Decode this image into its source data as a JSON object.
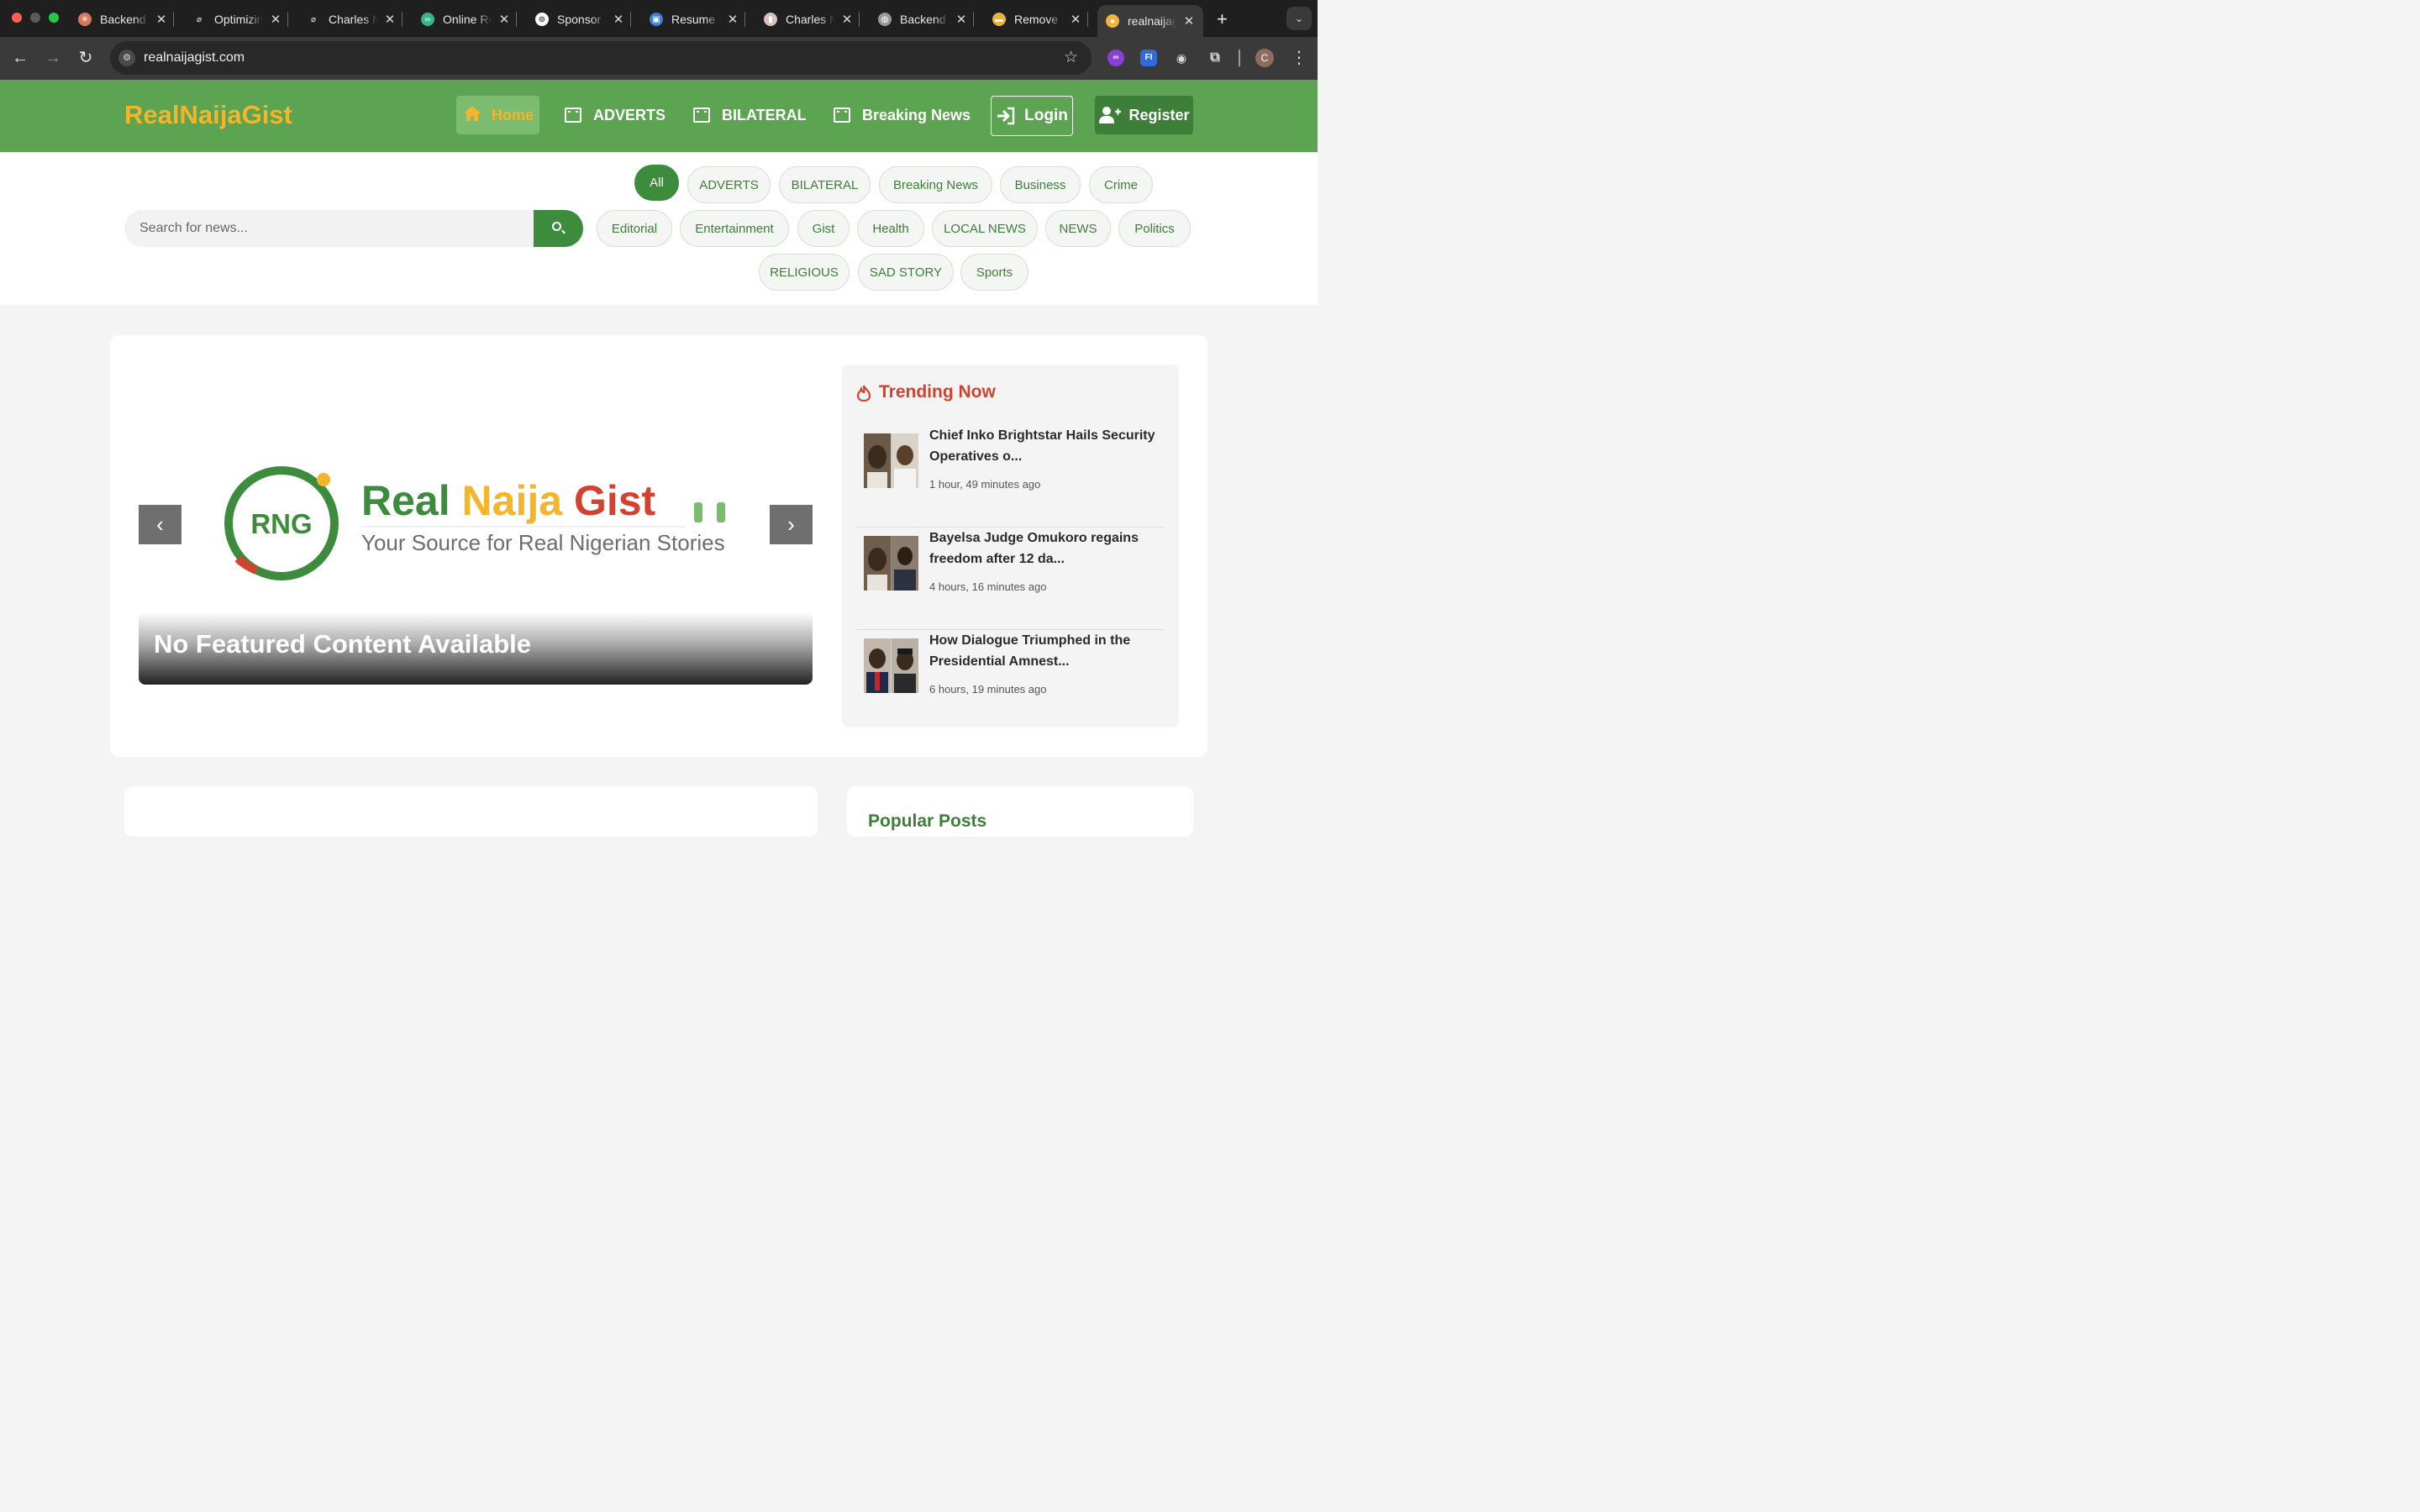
{
  "browser": {
    "tabs": [
      {
        "title": "Backend Developer",
        "fav_color": "#d97757",
        "fav": "✳"
      },
      {
        "title": "Optimizing",
        "fav_color": "#1f1f1f",
        "fav": "⌀"
      },
      {
        "title": "Charles Mbachu",
        "fav_color": "#1f1f1f",
        "fav": "⌀"
      },
      {
        "title": "Online Resume",
        "fav_color": "#38b48b",
        "fav": "∞"
      },
      {
        "title": "Sponsor a",
        "fav_color": "#ffffff",
        "fav": "⊚"
      },
      {
        "title": "Resume Builder",
        "fav_color": "#3f7fd8",
        "fav": "▣"
      },
      {
        "title": "Charles Mbachu",
        "fav_color": "#d8c0c0",
        "fav": "▮"
      },
      {
        "title": "Backend",
        "fav_color": "#9a9a9a",
        "fav": "◍"
      },
      {
        "title": "Remove Background",
        "fav_color": "#e8b33a",
        "fav": "▬"
      },
      {
        "title": "realnaijagist",
        "fav_color": "#f3b43a",
        "fav": "●"
      }
    ],
    "url": "realnaijagist.com",
    "profile_initial": "C"
  },
  "site": {
    "brand": "RealNaijaGist",
    "nav": {
      "home": "Home",
      "adverts": "ADVERTS",
      "bilateral": "BILATERAL",
      "breaking": "Breaking News",
      "login": "Login",
      "register": "Register"
    },
    "colors": {
      "primary": "#5ca352",
      "accent": "#f5b52a",
      "dark_green": "#3d8b3d",
      "trending": "#d3412f"
    }
  },
  "filters": {
    "search_placeholder": "Search for news...",
    "categories": [
      "All",
      "ADVERTS",
      "BILATERAL",
      "Breaking News",
      "Business",
      "Crime",
      "Editorial",
      "Entertainment",
      "Gist",
      "Health",
      "LOCAL NEWS",
      "NEWS",
      "Politics",
      "RELIGIOUS",
      "SAD STORY",
      "Sports"
    ],
    "active": "All"
  },
  "featured": {
    "logo_letters": "RNG",
    "logo_word_real": "Real",
    "logo_word_naija": "Naija",
    "logo_word_gist": "Gist",
    "logo_tagline": "Your Source for Real Nigerian Stories",
    "caption": "No Featured Content Available"
  },
  "trending": {
    "title": "Trending Now",
    "items": [
      {
        "headline": "Chief Inko Brightstar Hails Security Operatives o...",
        "time": "1 hour, 49 minutes ago"
      },
      {
        "headline": "Bayelsa Judge Omukoro regains freedom after 12 da...",
        "time": "4 hours, 16 minutes ago"
      },
      {
        "headline": "How Dialogue Triumphed in the Presidential Amnest...",
        "time": "6 hours, 19 minutes ago"
      }
    ]
  },
  "popular": {
    "title": "Popular Posts"
  }
}
